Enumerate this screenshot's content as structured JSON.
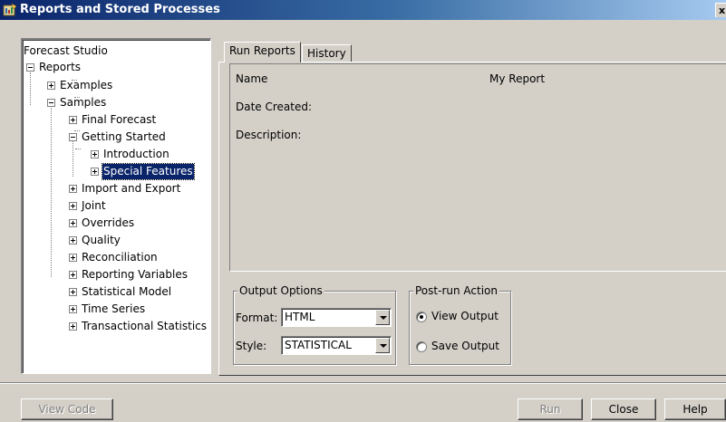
{
  "window": {
    "title": "Reports and Stored Processes",
    "close_label": "x"
  },
  "tree": {
    "root": "Forecast Studio",
    "reports": "Reports",
    "examples": "Examples",
    "samples": "Samples",
    "final_forecast": "Final Forecast",
    "getting_started": "Getting Started",
    "introduction": "Introduction",
    "special_features": "Special Features",
    "import_export": "Import and Export",
    "joint": "Joint",
    "overrides": "Overrides",
    "quality": "Quality",
    "reconciliation": "Reconciliation",
    "reporting_variables": "Reporting Variables",
    "statistical_model": "Statistical Model",
    "time_series": "Time Series",
    "transactional_statistics": "Transactional Statistics"
  },
  "tabs": {
    "run_reports": "Run Reports",
    "history": "History"
  },
  "info": {
    "name_label": "Name",
    "name_value": "My Report",
    "date_label": "Date Created:",
    "description_label": "Description:"
  },
  "output_options": {
    "legend": "Output Options",
    "format_label": "Format:",
    "format_value": "HTML",
    "style_label": "Style:",
    "style_value": "STATISTICAL"
  },
  "post_run": {
    "legend": "Post-run Action",
    "view_output": "View Output",
    "save_output": "Save Output",
    "selected": "View Output"
  },
  "buttons": {
    "view_code": "View Code",
    "run": "Run",
    "close": "Close",
    "help": "Help"
  }
}
